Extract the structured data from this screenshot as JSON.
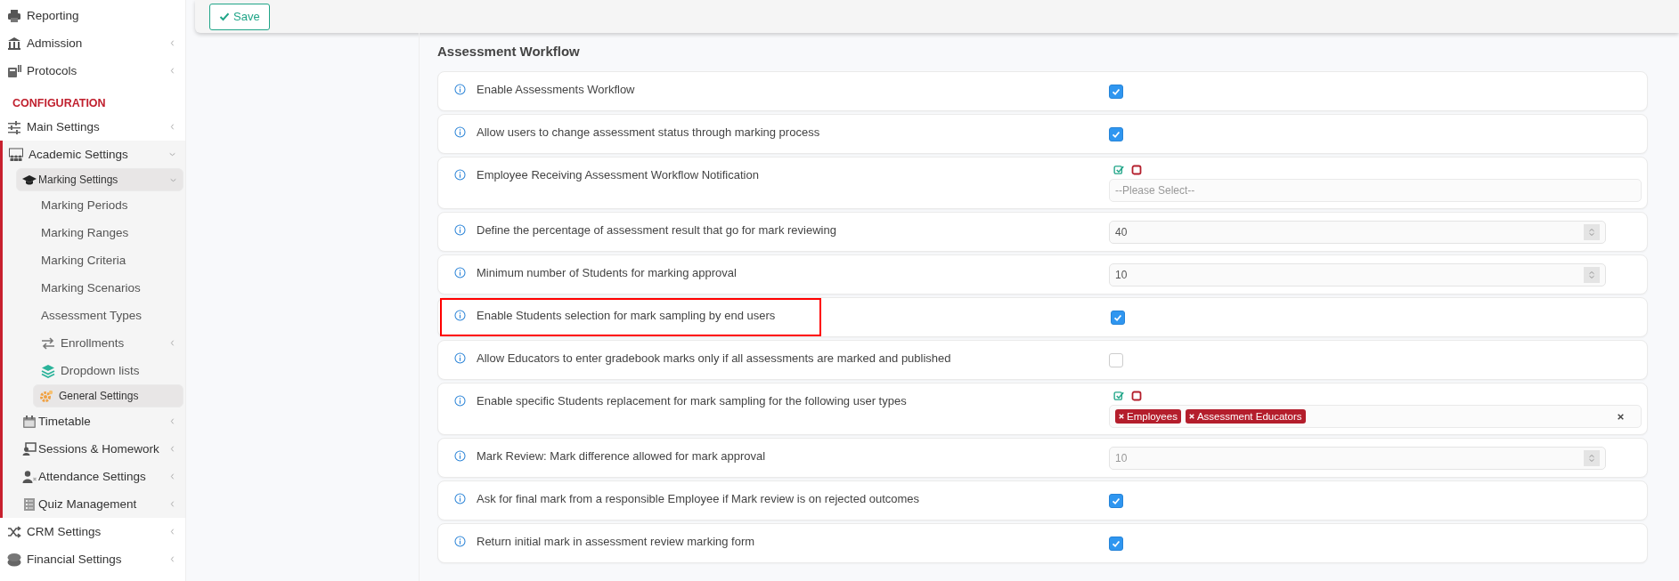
{
  "sidebar": {
    "items": [
      {
        "kind": "item",
        "label": "Reporting",
        "selected": false
      },
      {
        "kind": "item",
        "label": "Admission",
        "selected": false,
        "expanded": false
      },
      {
        "kind": "item",
        "label": "Protocols",
        "selected": false,
        "expanded": false
      },
      {
        "kind": "heading",
        "label": "CONFIGURATION"
      },
      {
        "kind": "item",
        "label": "Main Settings",
        "selected": false,
        "expanded": false
      },
      {
        "kind": "item",
        "label": "Academic Settings",
        "selected": false,
        "expanded": true,
        "children": [
          {
            "kind": "item",
            "label": "Marking Settings",
            "selected": true,
            "expanded": true,
            "children": [
              {
                "kind": "item",
                "label": "Marking Periods",
                "selected": false
              },
              {
                "kind": "item",
                "label": "Marking Ranges",
                "selected": false
              },
              {
                "kind": "item",
                "label": "Marking Criteria",
                "selected": false
              },
              {
                "kind": "item",
                "label": "Marking Scenarios",
                "selected": false
              },
              {
                "kind": "item",
                "label": "Assessment Types",
                "selected": false
              },
              {
                "kind": "item",
                "label": "Enrollments",
                "selected": false,
                "expanded": false
              },
              {
                "kind": "item",
                "label": "Dropdown lists",
                "selected": false
              },
              {
                "kind": "item",
                "label": "General Settings",
                "selected": true
              }
            ]
          },
          {
            "kind": "item",
            "label": "Timetable",
            "selected": false,
            "expanded": false
          },
          {
            "kind": "item",
            "label": "Sessions & Homework",
            "selected": false,
            "expanded": false
          },
          {
            "kind": "item",
            "label": "Attendance Settings",
            "selected": false,
            "expanded": false
          },
          {
            "kind": "item",
            "label": "Quiz Management",
            "selected": false,
            "expanded": false
          }
        ]
      },
      {
        "kind": "item",
        "label": "CRM Settings",
        "selected": false,
        "expanded": false
      },
      {
        "kind": "item",
        "label": "Financial Settings",
        "selected": false,
        "expanded": false
      }
    ]
  },
  "toolbar": {
    "save_button": "Save"
  },
  "section": {
    "title": "Assessment Workflow",
    "rows": [
      {
        "kind": "checkbox",
        "label": "Enable Assessments Workflow",
        "checked": true,
        "highlighted": false
      },
      {
        "kind": "checkbox",
        "label": "Allow users to change assessment status through marking process",
        "checked": true,
        "highlighted": false
      },
      {
        "kind": "select",
        "label": "Employee Receiving Assessment Workflow Notification",
        "placeholder": "--Please Select--",
        "highlighted": false
      },
      {
        "kind": "number",
        "label": "Define the percentage of assessment result that go for mark reviewing",
        "value": "40",
        "disabled": false,
        "highlighted": false
      },
      {
        "kind": "number",
        "label": "Minimum number of Students for marking approval",
        "value": "10",
        "disabled": false,
        "highlighted": false
      },
      {
        "kind": "checkbox",
        "label": "Enable Students selection for mark sampling by end users",
        "checked": true,
        "highlighted": true
      },
      {
        "kind": "checkbox",
        "label": "Allow Educators to enter gradebook marks only if all assessments are marked and published",
        "checked": false,
        "highlighted": false
      },
      {
        "kind": "tags",
        "label": "Enable specific Students replacement for mark sampling for the following user types",
        "tags": [
          "Employees",
          "Assessment Educators"
        ],
        "highlighted": false
      },
      {
        "kind": "number",
        "label": "Mark Review: Mark difference allowed for mark approval",
        "value": "10",
        "disabled": true,
        "highlighted": false
      },
      {
        "kind": "checkbox",
        "label": "Ask for final mark from a responsible Employee if Mark review is on rejected outcomes",
        "checked": true,
        "highlighted": false
      },
      {
        "kind": "checkbox",
        "label": "Return initial mark in assessment review marking form",
        "checked": true,
        "highlighted": false
      }
    ]
  }
}
